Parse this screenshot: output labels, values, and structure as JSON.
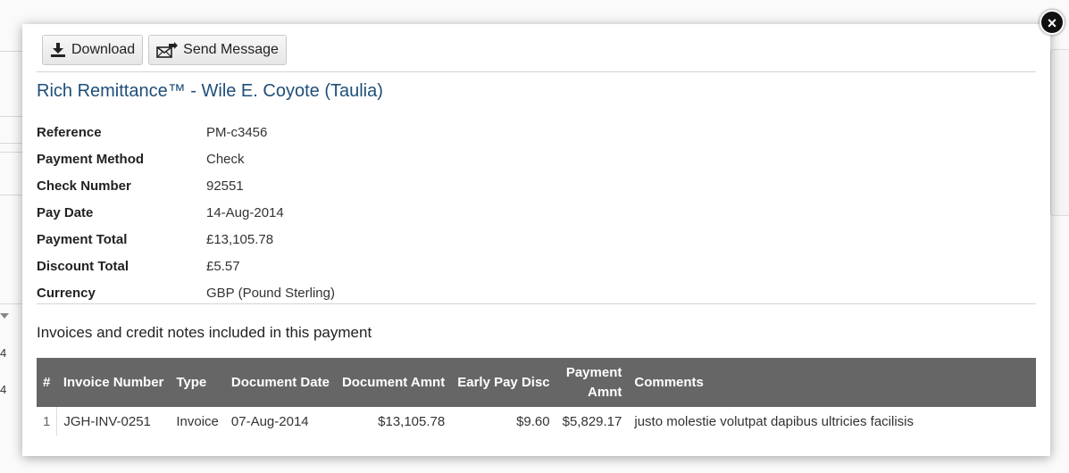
{
  "background": {
    "row_values": [
      "4",
      "4"
    ]
  },
  "close": {
    "symbol": "×"
  },
  "toolbar": {
    "download_label": "Download",
    "send_message_label": "Send Message"
  },
  "title": "Rich Remittance™ - Wile E. Coyote (Taulia)",
  "details": [
    {
      "label": "Reference",
      "value": "PM-c3456"
    },
    {
      "label": "Payment Method",
      "value": "Check"
    },
    {
      "label": "Check Number",
      "value": "92551"
    },
    {
      "label": "Pay Date",
      "value": "14-Aug-2014"
    },
    {
      "label": "Payment Total",
      "value": "£13,105.78"
    },
    {
      "label": "Discount Total",
      "value": "£5.57"
    },
    {
      "label": "Currency",
      "value": "GBP (Pound Sterling)"
    }
  ],
  "invoices_heading": "Invoices and credit notes included in this payment",
  "table": {
    "headers": {
      "num": "#",
      "invoice_number": "Invoice Number",
      "type": "Type",
      "document_date": "Document Date",
      "document_amnt": "Document Amnt",
      "early_pay_disc": "Early Pay Disc",
      "payment_amnt_1": "Payment",
      "payment_amnt_2": "Amnt",
      "comments": "Comments"
    },
    "rows": [
      {
        "num": "1",
        "invoice_number": "JGH-INV-0251",
        "type": "Invoice",
        "document_date": "07-Aug-2014",
        "document_amnt": "$13,105.78",
        "early_pay_disc": "$9.60",
        "payment_amnt": "$5,829.17",
        "comments": "justo molestie volutpat dapibus ultricies facilisis"
      }
    ]
  }
}
